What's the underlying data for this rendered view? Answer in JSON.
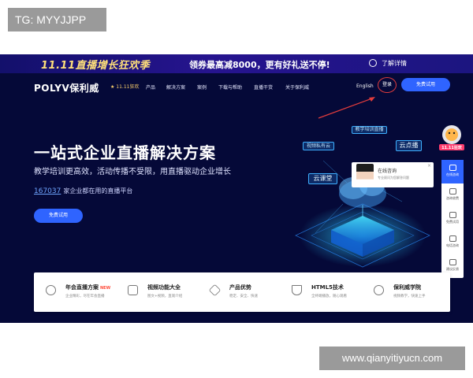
{
  "watermark": {
    "top_left": "TG: MYYJJPP",
    "bottom_right": "www.qianyitiyucn.com"
  },
  "promo": {
    "tag": "11.11直播增长狂欢季",
    "message": "领券最高减8000，更有好礼送不停!",
    "more_label": "了解详情"
  },
  "nav": {
    "logo": "POLYV保利威",
    "badge": "11.11狂欢",
    "links": [
      "产品",
      "解决方案",
      "案例",
      "下载与帮助",
      "直播干货",
      "关于保利威"
    ],
    "lang": "English",
    "login": "登录",
    "trial": "免费试用"
  },
  "hero": {
    "title": "一站式企业直播解决方案",
    "subtitle": "教学培训更高效，活动传播不受限，用直播驱动企业增长",
    "stat_number": "167037",
    "stat_text": "家企业都在用的直播平台",
    "cta": "免费试用"
  },
  "illustration": {
    "chips": [
      "教学培训直播",
      "视频私有云",
      "云点播",
      "云课堂"
    ]
  },
  "consult": {
    "title": "在线咨询",
    "subtitle": "专业顾问为您解答问题"
  },
  "side": {
    "badge": "11.11狂欢",
    "items": [
      "在线咨询",
      "咨询收费",
      "免费试用",
      "电话咨询",
      "建议反馈"
    ]
  },
  "features": [
    {
      "title": "年会直播方案",
      "tag": "NEW",
      "desc": "企业精彩，尽在年会直播",
      "icon": "play-circle-icon"
    },
    {
      "title": "视频功能大全",
      "tag": "",
      "desc": "图文+视频，直观介绍",
      "icon": "video-list-icon"
    },
    {
      "title": "产品优势",
      "tag": "",
      "desc": "稳定、安全、快速",
      "icon": "cube-icon"
    },
    {
      "title": "HTML5技术",
      "tag": "",
      "desc": "全终端播放，随心观看",
      "icon": "html5-icon"
    },
    {
      "title": "保利威学院",
      "tag": "",
      "desc": "视频教学，快速上手",
      "icon": "academy-icon"
    }
  ],
  "colors": {
    "bg": "#050938",
    "accent": "#2f64ff",
    "login_ring": "#e23c3c",
    "new_tag": "#ff4b3a"
  }
}
